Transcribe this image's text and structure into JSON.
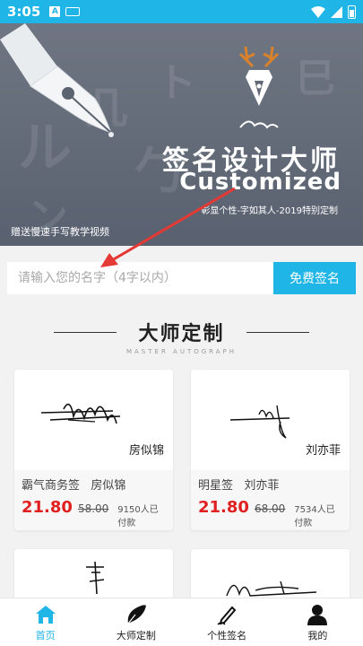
{
  "status_bar": {
    "time": "3:05",
    "a_icon": "A"
  },
  "banner": {
    "title": "签名设计大师",
    "subtitle": "Customized",
    "slogan": "彰显个性-字如其人-2019特别定制",
    "promo": "赠送慢速手写教学视频"
  },
  "search": {
    "placeholder": "请输入您的名字（4字以内）",
    "button_label": "免费签名"
  },
  "section": {
    "title": "大师定制",
    "subtitle": "MASTER AUTOGRAPH"
  },
  "cards": [
    {
      "sig_name": "房似锦",
      "name": "霸气商务签   房似锦",
      "price": "21.80",
      "orig_price": "58.00",
      "paid": "9150人已付款"
    },
    {
      "sig_name": "刘亦菲",
      "name": "明星签   刘亦菲",
      "price": "21.80",
      "orig_price": "68.00",
      "paid": "7534人已付款"
    },
    {
      "sig_name": "",
      "name": "",
      "price": "",
      "orig_price": "",
      "paid": ""
    },
    {
      "sig_name": "",
      "name": "",
      "price": "",
      "orig_price": "",
      "paid": ""
    }
  ],
  "nav": [
    {
      "label": "首页",
      "icon": "home-icon"
    },
    {
      "label": "大师定制",
      "icon": "pen-nib-icon"
    },
    {
      "label": "个性签名",
      "icon": "edit-signature-icon"
    },
    {
      "label": "我的",
      "icon": "user-icon"
    }
  ],
  "colors": {
    "accent": "#1fb5e6",
    "price": "#e02020",
    "banner": "#636a76"
  }
}
